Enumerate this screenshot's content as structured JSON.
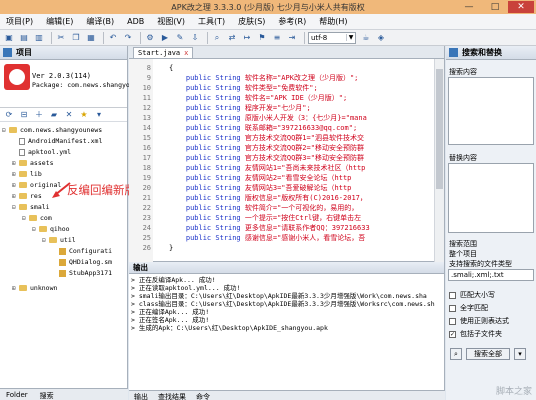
{
  "window": {
    "title": "APK改之理 3.3.3.0 (少月版) 七少月与小米人共有版权",
    "min": "—",
    "max": "□",
    "close": "✕"
  },
  "menu": [
    "项目(P)",
    "编辑(E)",
    "编译(B)",
    "ADB",
    "视图(V)",
    "工具(T)",
    "皮肤(S)",
    "参考(R)",
    "帮助(H)"
  ],
  "toolbar": {
    "encoding": "utf-8"
  },
  "project": {
    "header": "项目",
    "version": "Ver 2.0.3(114)",
    "package": "Package: com.news.shangyouw"
  },
  "tree": {
    "root": "com.news.shangyounews",
    "items": [
      "AndroidManifest.xml",
      "apktool.yml",
      "assets",
      "lib",
      "original",
      "res",
      "smali",
      "com",
      "qihoo",
      "util",
      "Configurati",
      "QHDialog.sm",
      "StubApp3171",
      "unknown"
    ]
  },
  "annotation": "反编回编新版360壳",
  "bottom_tabs": [
    "Folder",
    "搜索"
  ],
  "editor": {
    "tab": "Start.java",
    "close": "x",
    "lines": [
      {
        "n": "8",
        "pre": "",
        "kw": "",
        "code": "{"
      },
      {
        "n": "9",
        "pre": "    ",
        "kw": "public String",
        "code": " 软件名称=\"APK改之理（少月版）\";"
      },
      {
        "n": "10",
        "pre": "    ",
        "kw": "public String",
        "code": " 软件类型=\"免费软件\";"
      },
      {
        "n": "11",
        "pre": "    ",
        "kw": "public String",
        "code": " 软件名=\"APK IDE（少月版）\";"
      },
      {
        "n": "12",
        "pre": "    ",
        "kw": "public String",
        "code": " 程序开发=\"七少月\";"
      },
      {
        "n": "13",
        "pre": "    ",
        "kw": "public String",
        "code": " 原版小米人开发（3：{七少月}=\"mana"
      },
      {
        "n": "14",
        "pre": "    ",
        "kw": "public String",
        "code": " 联系邮箱=\"397216633@qq.com\";"
      },
      {
        "n": "15",
        "pre": "    ",
        "kw": "public String",
        "code": " 官方技术交流QQ群1=\"泗县软件技术交"
      },
      {
        "n": "16",
        "pre": "    ",
        "kw": "public String",
        "code": " 官方技术交流QQ群2=\"移动安全预防群"
      },
      {
        "n": "17",
        "pre": "    ",
        "kw": "public String",
        "code": " 官方技术交流QQ群3=\"移动安全预防群"
      },
      {
        "n": "18",
        "pre": "    ",
        "kw": "public String",
        "code": " 友情网站1=\"吾尚未来技术社区（http"
      },
      {
        "n": "19",
        "pre": "    ",
        "kw": "public String",
        "code": " 友情网站2=\"看雪安全论坛（http"
      },
      {
        "n": "20",
        "pre": "    ",
        "kw": "public String",
        "code": " 友情网站3=\"吾爱破解论坛（http"
      },
      {
        "n": "21",
        "pre": "    ",
        "kw": "public String",
        "code": " 版权信息=\"版权所有(C)2016-2017，"
      },
      {
        "n": "22",
        "pre": "    ",
        "kw": "public String",
        "code": " 软件简介=\"一个可视化的，易用的，"
      },
      {
        "n": "23",
        "pre": "    ",
        "kw": "public String",
        "code": " 一个提示=\"按住Ctrl键，右键单击左"
      },
      {
        "n": "24",
        "pre": "    ",
        "kw": "public String",
        "code": " 更多信息=\"请联系作者QQ：397216633"
      },
      {
        "n": "25",
        "pre": "    ",
        "kw": "public String",
        "code": " 感谢信息=\"感谢小米人，看雪论坛，吾"
      },
      {
        "n": "26",
        "pre": "",
        "kw": "",
        "code": "}"
      }
    ]
  },
  "output": {
    "header": "输出",
    "lines": [
      "> 正在反编译Apk... 成功!",
      "> 正在读取apktool.yml... 成功!",
      "> smali输出目录：C:\\Users\\红\\Desktop\\ApkIDE最新3.3.3少月增强版\\Work\\com.news.sha",
      "> class输出目录：C:\\Users\\红\\Desktop\\ApkIDE最新3.3.3少月增强版\\Worksrc\\com.news.sh",
      "> 正在编译Apk... 成功!",
      "> 正在签名Apk... 成功!",
      "> 生成的Apk：C:\\Users\\红\\Desktop\\ApkIDE_shangyou.apk"
    ],
    "tabs": [
      "输出",
      "查找结果",
      "命令"
    ]
  },
  "right": {
    "header": "搜索和替换",
    "search_label": "搜索内容",
    "replace_label": "替换内容",
    "scope_label": "搜索范围",
    "scope_value": "整个项目",
    "types_label": "支持搜索的文件类型",
    "types_value": ".smali;.xml;.txt",
    "options": [
      {
        "label": "匹配大小写",
        "checked": false
      },
      {
        "label": "全字匹配",
        "checked": false
      },
      {
        "label": "使用正则表达式",
        "checked": false
      },
      {
        "label": "包括子文件夹",
        "checked": true
      }
    ],
    "search_btn": "搜索全部",
    "check": "✓"
  },
  "watermark": "脚本之家"
}
